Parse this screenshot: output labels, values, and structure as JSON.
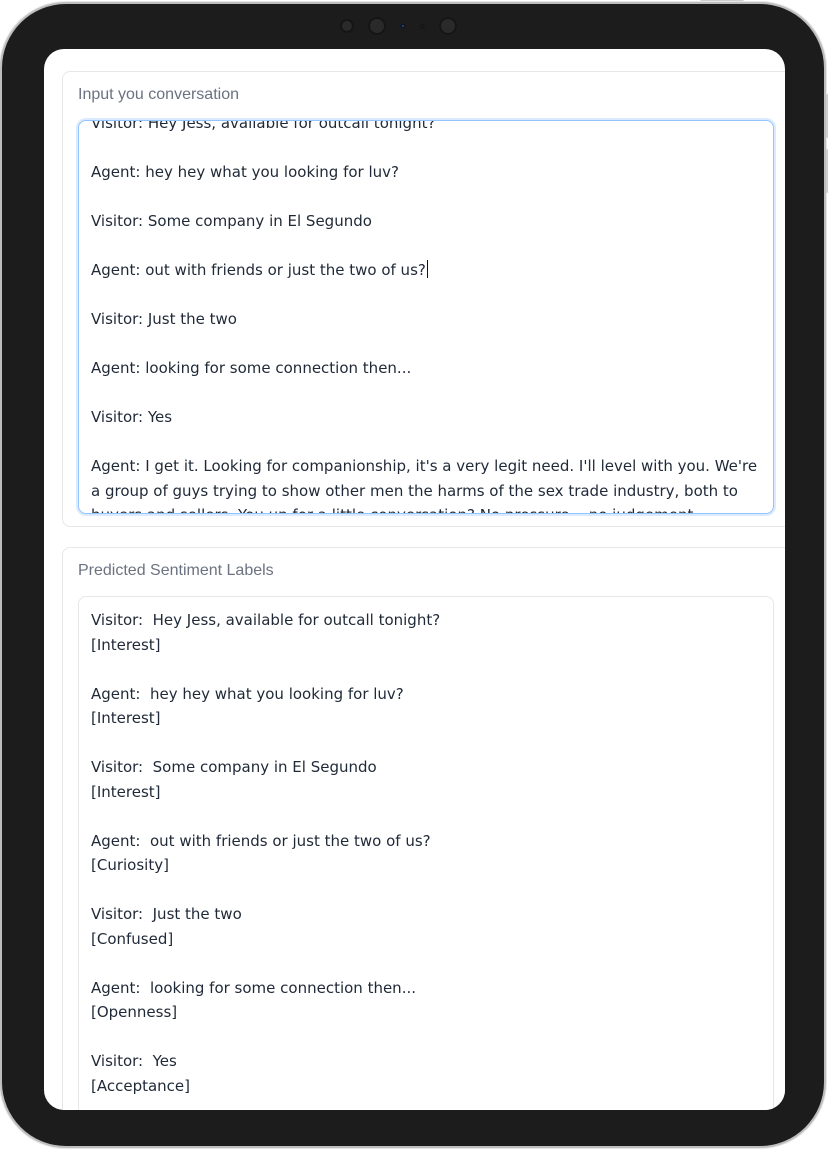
{
  "input_panel": {
    "label": "Input you conversation",
    "lines": [
      "Visitor: Hey Jess, available for outcall tonight?",
      "",
      "Agent: hey hey what you looking for luv?",
      "",
      "Visitor: Some company in El Segundo",
      "",
      "Agent: out with friends or just the two of us?",
      "",
      "Visitor: Just the two",
      "",
      "Agent: looking for some connection then...",
      "",
      "Visitor: Yes",
      ""
    ],
    "last_message": "Agent: I get it. Looking for companionship, it's a very legit need. I'll level with you. We're a group of guys trying to show other men the harms of the sex trade industry, both to buyers and sellers. You up for a little conversation? No pressure... no judgement."
  },
  "output_panel": {
    "label": "Predicted Sentiment Labels",
    "entries": [
      {
        "message": "Visitor:  Hey Jess, available for outcall tonight?",
        "label": "[Interest]"
      },
      {
        "message": "Agent:  hey hey what you looking for luv?",
        "label": "[Interest]"
      },
      {
        "message": "Visitor:  Some company in El Segundo",
        "label": "[Interest]"
      },
      {
        "message": "Agent:  out with friends or just the two of us?",
        "label": "[Curiosity]"
      },
      {
        "message": "Visitor:  Just the two",
        "label": "[Confused]"
      },
      {
        "message": "Agent:  looking for some connection then...",
        "label": "[Openness]"
      },
      {
        "message": "Visitor:  Yes",
        "label": "[Acceptance]"
      }
    ]
  },
  "colors": {
    "label_text": "#6b7280",
    "body_text": "#1f2937",
    "focus_border": "#93c5fd",
    "device_frame": "#1c1c1c"
  }
}
